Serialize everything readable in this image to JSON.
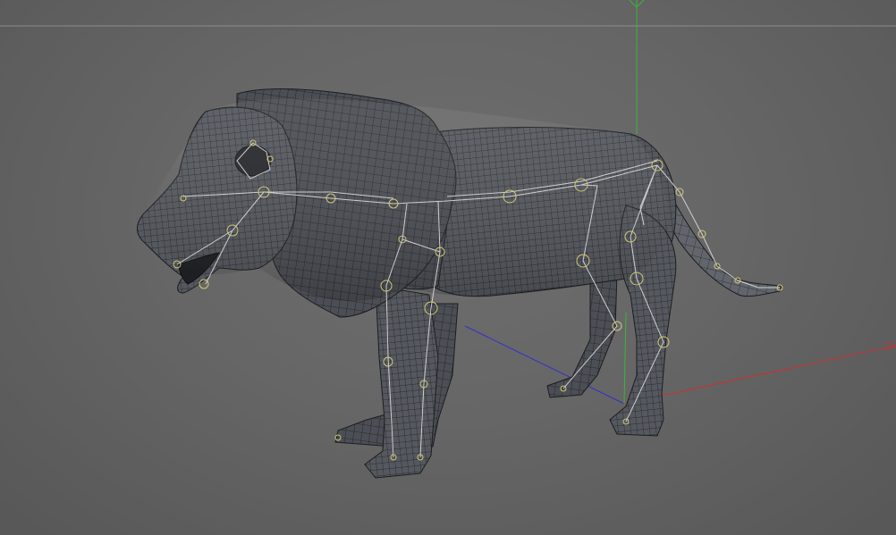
{
  "viewport": {
    "background_color": "#666666",
    "horizon_color": "#8a8a8a",
    "axis_colors": {
      "x": "#c83232",
      "y": "#3cb43c",
      "z": "#3232c8"
    }
  },
  "model": {
    "subject": "lion",
    "display": "wireframe-mesh-with-bone-rig",
    "mesh_fill": "#4a4d52",
    "mesh_line": "#1a1b1e",
    "bone_color": "#dcdcdc",
    "joint_color": "#d2c878"
  }
}
